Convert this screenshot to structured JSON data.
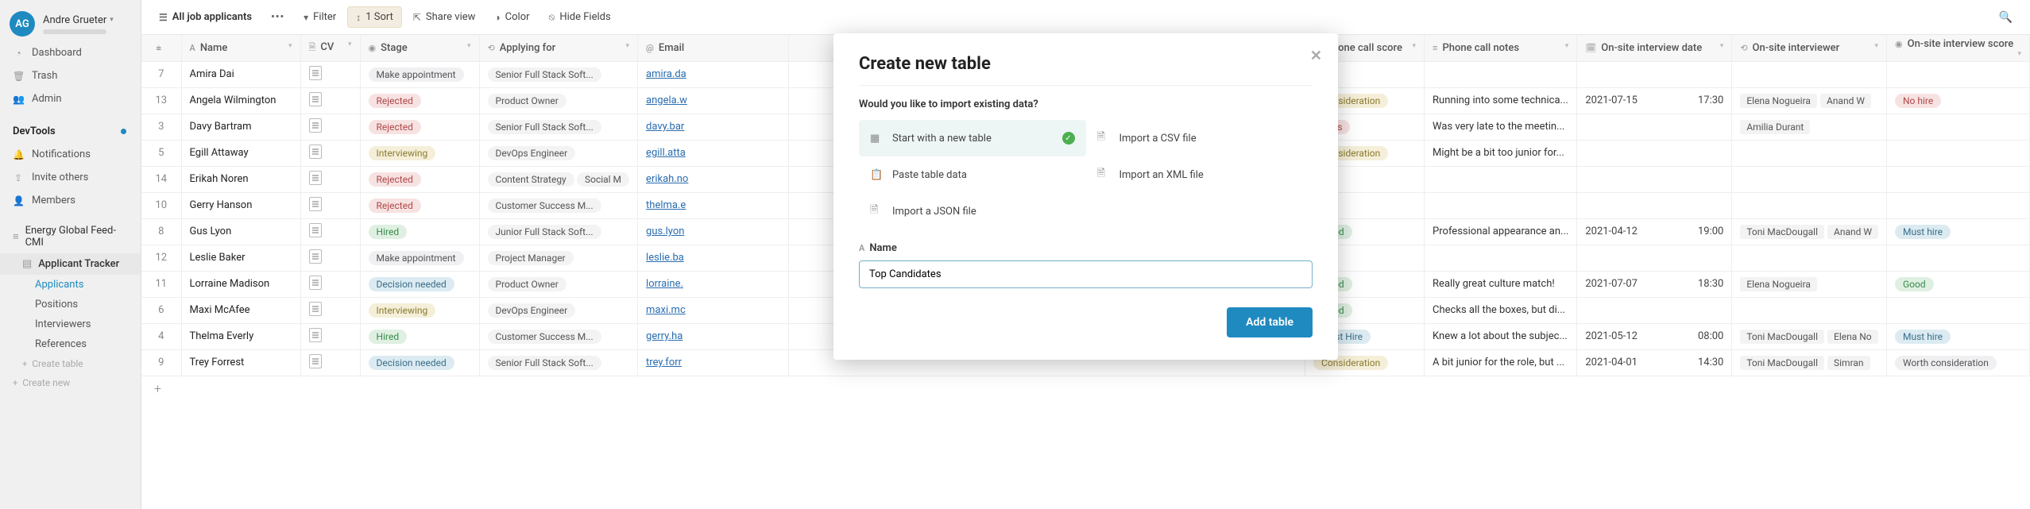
{
  "user": {
    "initials": "AG",
    "name": "Andre Grueter"
  },
  "nav": {
    "dashboard": "Dashboard",
    "trash": "Trash",
    "admin": "Admin",
    "devtools": "DevTools",
    "notifications": "Notifications",
    "invite": "Invite others",
    "members": "Members"
  },
  "workspace": {
    "name": "Energy Global Feed-CMI",
    "tracker": "Applicant Tracker",
    "tables": [
      "Applicants",
      "Positions",
      "Interviewers",
      "References"
    ],
    "create_table": "Create table",
    "create_new": "Create new"
  },
  "toolbar": {
    "view": "All job applicants",
    "filter": "Filter",
    "sort": "1 Sort",
    "share": "Share view",
    "color": "Color",
    "hide": "Hide Fields"
  },
  "headers": {
    "name": "Name",
    "cv": "CV",
    "stage": "Stage",
    "applying": "Applying for",
    "email": "Email",
    "pscore": "Phone call score",
    "pnotes": "Phone call notes",
    "odate": "On-site interview date",
    "oint": "On-site interviewer",
    "oscore": "On-site interview score"
  },
  "rows": [
    {
      "num": "7",
      "name": "Amira Dai",
      "stage": "Make appointment",
      "stage_cls": "make-appointment",
      "apply": "Senior Full Stack Soft...",
      "email": "amira.da",
      "pscore": "",
      "pnotes": "",
      "date": "",
      "time": "",
      "interviewers": [],
      "oscore": "",
      "oscore_cls": ""
    },
    {
      "num": "13",
      "name": "Angela Wilmington",
      "stage": "Rejected",
      "stage_cls": "rejected",
      "apply": "Product Owner",
      "email": "angela.w",
      "pscore": "Consideration",
      "pnotes": "Running into some technica...",
      "date": "2021-07-15",
      "time": "17:30",
      "interviewers": [
        "Elena Nogueira",
        "Anand W"
      ],
      "oscore": "No hire",
      "oscore_cls": "no-hire"
    },
    {
      "num": "3",
      "name": "Davy Bartram",
      "stage": "Rejected",
      "stage_cls": "rejected",
      "apply": "Senior Full Stack Soft...",
      "email": "davy.bar",
      "pscore": "Pass",
      "pnotes": "Was very late to the meetin...",
      "date": "",
      "time": "",
      "interviewers": [
        "Amilia Durant"
      ],
      "oscore": "",
      "oscore_cls": ""
    },
    {
      "num": "5",
      "name": "Egill Attaway",
      "stage": "Interviewing",
      "stage_cls": "interviewing",
      "apply": "DevOps Engineer",
      "email": "egill.atta",
      "pscore": "Consideration",
      "pnotes": "Might be a bit too junior for...",
      "date": "",
      "time": "",
      "interviewers": [],
      "oscore": "",
      "oscore_cls": ""
    },
    {
      "num": "14",
      "name": "Erikah Noren",
      "stage": "Rejected",
      "stage_cls": "rejected",
      "apply": "Content Strategy",
      "apply2": "Social M",
      "email": "erikah.no",
      "pscore": "",
      "pnotes": "",
      "date": "",
      "time": "",
      "interviewers": [],
      "oscore": "",
      "oscore_cls": ""
    },
    {
      "num": "10",
      "name": "Gerry Hanson",
      "stage": "Rejected",
      "stage_cls": "rejected",
      "apply": "Customer Success M...",
      "email": "thelma.e",
      "pscore": "",
      "pnotes": "",
      "date": "",
      "time": "",
      "interviewers": [],
      "oscore": "",
      "oscore_cls": ""
    },
    {
      "num": "8",
      "name": "Gus Lyon",
      "stage": "Hired",
      "stage_cls": "hired",
      "apply": "Junior Full Stack Soft...",
      "email": "gus.lyon",
      "pscore": "Good",
      "pnotes": "Professional appearance an...",
      "date": "2021-04-12",
      "time": "19:00",
      "interviewers": [
        "Toni MacDougall",
        "Anand W"
      ],
      "oscore": "Must hire",
      "oscore_cls": "must-hire"
    },
    {
      "num": "12",
      "name": "Leslie Baker",
      "stage": "Make appointment",
      "stage_cls": "make-appointment",
      "apply": "Project Manager",
      "email": "leslie.ba",
      "pscore": "",
      "pnotes": "",
      "date": "",
      "time": "",
      "interviewers": [],
      "oscore": "",
      "oscore_cls": ""
    },
    {
      "num": "11",
      "name": "Lorraine Madison",
      "stage": "Decision needed",
      "stage_cls": "decision-needed",
      "apply": "Product Owner",
      "email": "lorraine.",
      "pscore": "Good",
      "pnotes": "Really great culture match!",
      "date": "2021-07-07",
      "time": "18:30",
      "interviewers": [
        "Elena Nogueira"
      ],
      "oscore": "Good",
      "oscore_cls": "good"
    },
    {
      "num": "6",
      "name": "Maxi McAfee",
      "stage": "Interviewing",
      "stage_cls": "interviewing",
      "apply": "DevOps Engineer",
      "email": "maxi.mc",
      "pscore": "Good",
      "pnotes": "Checks all the boxes, but di...",
      "date": "",
      "time": "",
      "interviewers": [],
      "oscore": "",
      "oscore_cls": ""
    },
    {
      "num": "4",
      "name": "Thelma Everly",
      "stage": "Hired",
      "stage_cls": "hired",
      "apply": "Customer Success M...",
      "email": "gerry.ha",
      "pscore": "Must Hire",
      "pnotes": "Knew a lot about the subjec...",
      "date": "2021-05-12",
      "time": "08:00",
      "interviewers": [
        "Toni MacDougall",
        "Elena No"
      ],
      "oscore": "Must hire",
      "oscore_cls": "must-hire"
    },
    {
      "num": "9",
      "name": "Trey Forrest",
      "stage": "Decision needed",
      "stage_cls": "decision-needed",
      "apply": "Senior Full Stack Soft...",
      "email": "trey.forr",
      "pscore": "Consideration",
      "pnotes": "A bit junior for the role, but ...",
      "date": "2021-04-01",
      "time": "14:30",
      "interviewers": [
        "Toni MacDougall",
        "Simran"
      ],
      "oscore": "Worth consideration",
      "oscore_cls": "worth-consideration"
    }
  ],
  "pscore_cls": {
    "Consideration": "consideration",
    "Pass": "pass",
    "Good": "good",
    "Must Hire": "must-hire"
  },
  "modal": {
    "title": "Create new table",
    "question": "Would you like to import existing data?",
    "opts": {
      "new": "Start with a new table",
      "csv": "Import a CSV file",
      "paste": "Paste table data",
      "xml": "Import an XML file",
      "json": "Import a JSON file"
    },
    "name_label": "Name",
    "name_value": "Top Candidates",
    "submit": "Add table"
  }
}
